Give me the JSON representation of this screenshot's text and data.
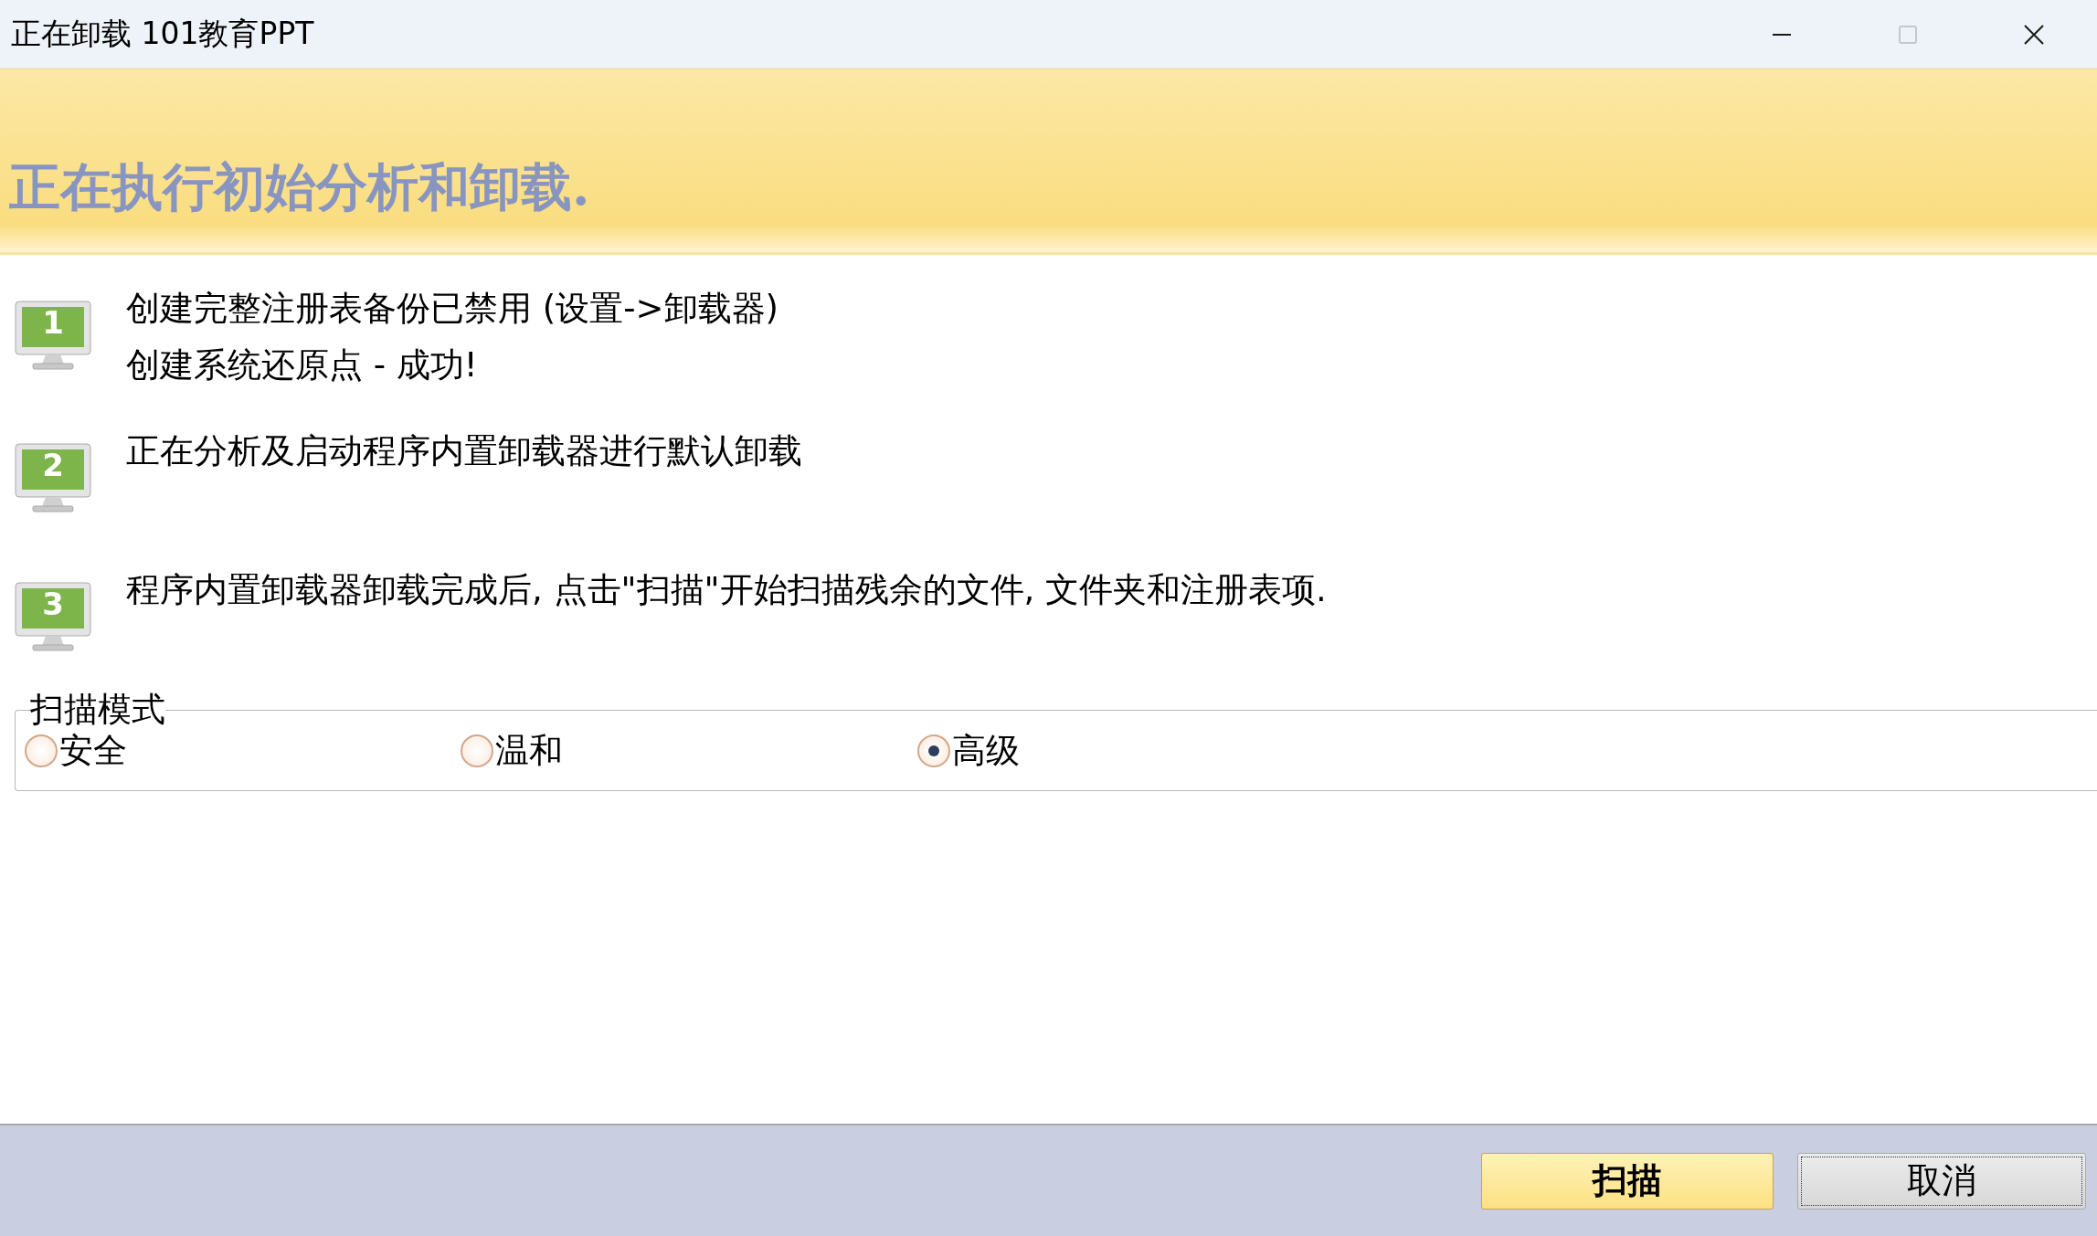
{
  "window": {
    "title": "正在卸载 101教育PPT",
    "controls": [
      {
        "kind": "minimize",
        "disabled": false
      },
      {
        "kind": "maximize",
        "disabled": true
      },
      {
        "kind": "close",
        "disabled": false
      }
    ]
  },
  "header": {
    "title": "正在执行初始分析和卸载."
  },
  "steps": [
    {
      "number": "1",
      "lines": [
        "创建完整注册表备份已禁用 (设置->卸载器)",
        "创建系统还原点 - 成功!"
      ]
    },
    {
      "number": "2",
      "lines": [
        "正在分析及启动程序内置卸载器进行默认卸载"
      ]
    },
    {
      "number": "3",
      "lines": [
        "程序内置卸载器卸载完成后, 点击\"扫描\"开始扫描残余的文件, 文件夹和注册表项."
      ]
    }
  ],
  "scan_mode": {
    "label": "扫描模式",
    "options": [
      {
        "label": "安全",
        "selected": false
      },
      {
        "label": "温和",
        "selected": false
      },
      {
        "label": "高级",
        "selected": true
      }
    ]
  },
  "buttons": [
    {
      "label": "扫描",
      "kind": "primary"
    },
    {
      "label": "取消",
      "kind": "secondary"
    }
  ]
}
